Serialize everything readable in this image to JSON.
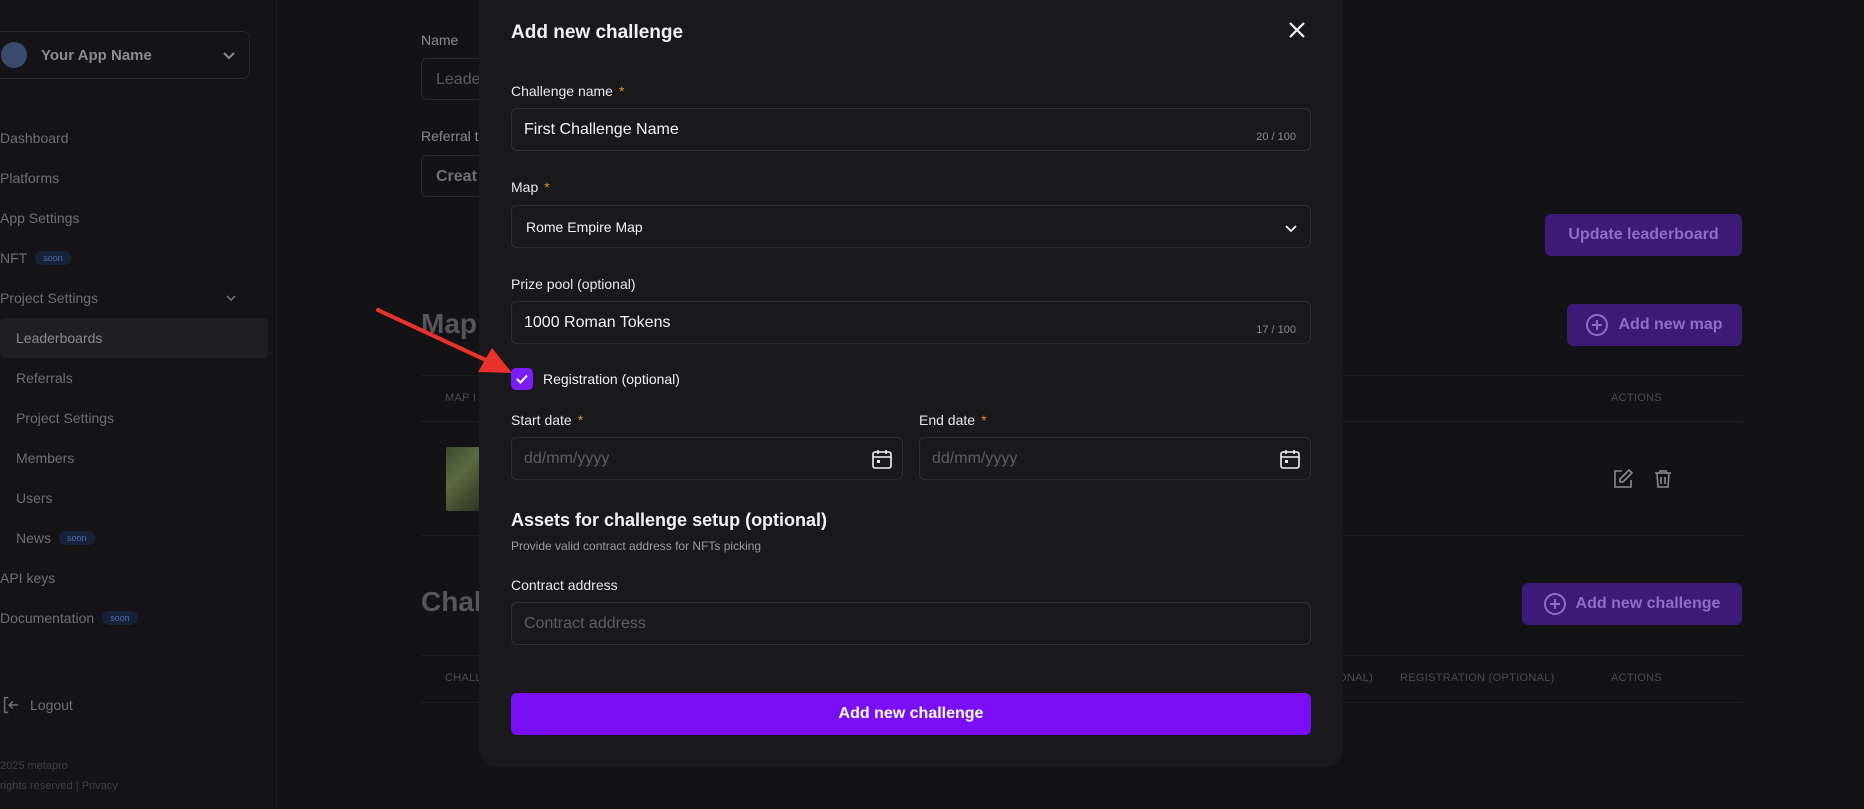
{
  "sidebar": {
    "app_name": "Your App Name",
    "items": [
      {
        "label": "Dashboard"
      },
      {
        "label": "Platforms"
      },
      {
        "label": "App Settings"
      },
      {
        "label": "NFT",
        "badge": "soon"
      },
      {
        "label": "Project Settings"
      },
      {
        "label": "Leaderboards"
      },
      {
        "label": "Referrals"
      },
      {
        "label": "Project Settings"
      },
      {
        "label": "Members"
      },
      {
        "label": "Users"
      },
      {
        "label": "News",
        "badge": "soon"
      },
      {
        "label": "API keys"
      },
      {
        "label": "Documentation",
        "badge": "soon"
      }
    ],
    "logout": "Logout",
    "footer_line1": "2025 metapro",
    "footer_line2": "rights reserved | Privacy"
  },
  "background": {
    "name_label": "Name",
    "name_value": "Leade",
    "referral_label": "Referral t",
    "create_value": "Creat",
    "update_button": "Update leaderboard",
    "maps_heading": "Map",
    "add_map_button": "Add new map",
    "map_col": "MAP I",
    "actions_col": "ACTIONS",
    "challenges_heading": "Chal",
    "add_challenge_button": "Add new challenge",
    "ch_col": "CHALL",
    "onal_col": "ONAL)",
    "registration_col": "REGISTRATION (OPTIONAL)",
    "actions_col2": "ACTIONS"
  },
  "modal": {
    "title": "Add new challenge",
    "challenge_name_label": "Challenge name",
    "challenge_name_value": "First Challenge Name",
    "challenge_name_counter": "20 / 100",
    "map_label": "Map",
    "map_value": "Rome Empire Map",
    "prize_label": "Prize pool (optional)",
    "prize_value": "1000 Roman Tokens",
    "prize_counter": "17 / 100",
    "registration_label": "Registration (optional)",
    "registration_checked": true,
    "start_label": "Start date",
    "start_placeholder": "dd/mm/yyyy",
    "end_label": "End date",
    "end_placeholder": "dd/mm/yyyy",
    "assets_title": "Assets for challenge setup (optional)",
    "assets_sub": "Provide valid contract address for NFTs picking",
    "contract_label": "Contract address",
    "contract_placeholder": "Contract address",
    "submit_label": "Add new challenge",
    "required_mark": "*"
  },
  "colors": {
    "accent": "#7a0ff7",
    "required": "#e88a2a",
    "annotation_arrow": "#e8322a"
  }
}
